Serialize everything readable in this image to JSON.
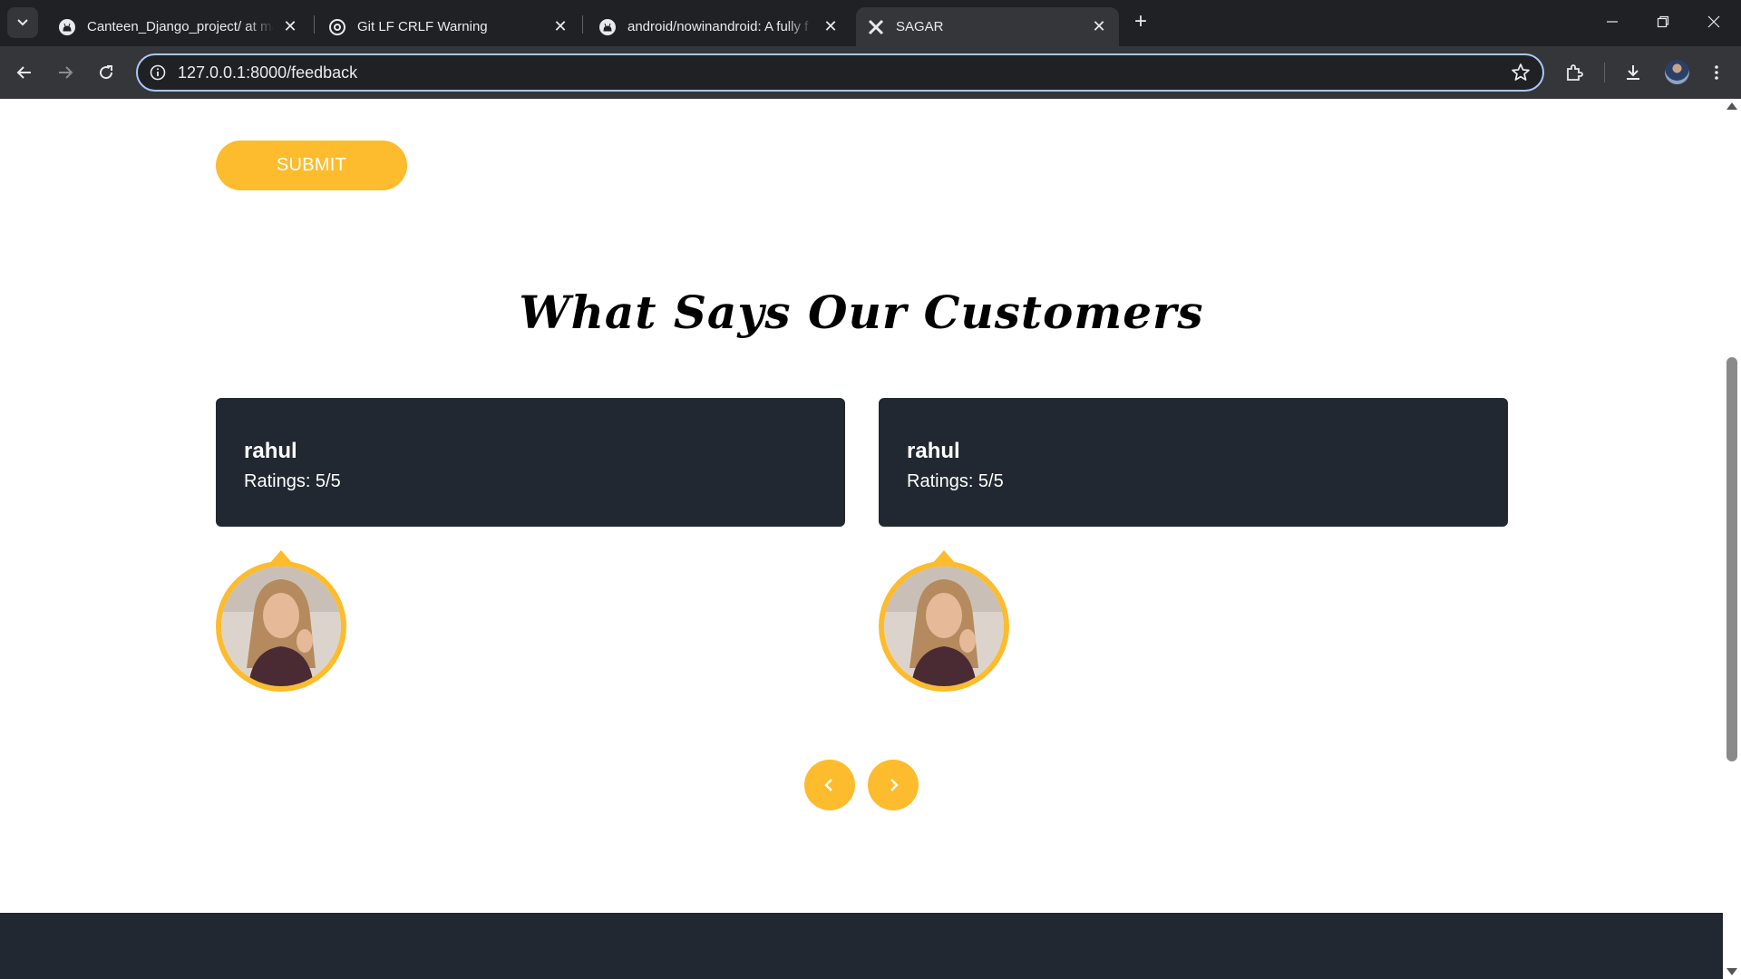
{
  "browser": {
    "tabs": [
      {
        "title": "Canteen_Django_project/ at ma",
        "icon": "github-icon",
        "active": false
      },
      {
        "title": "Git LF CRLF Warning",
        "icon": "openai-icon",
        "active": false
      },
      {
        "title": "android/nowinandroid: A fully f",
        "icon": "github-icon",
        "active": false
      },
      {
        "title": "SAGAR",
        "icon": "restaurant-icon",
        "active": true
      }
    ],
    "url": "127.0.0.1:8000/feedback"
  },
  "page": {
    "submit_label": "SUBMIT",
    "section_title": "What Says Our Customers",
    "testimonials": [
      {
        "name": "rahul",
        "rating": "Ratings: 5/5"
      },
      {
        "name": "rahul",
        "rating": "Ratings: 5/5"
      }
    ]
  },
  "colors": {
    "accent": "#fdbc2d",
    "card_bg": "#222831",
    "chrome_dark": "#202124",
    "chrome_toolbar": "#35363a"
  }
}
